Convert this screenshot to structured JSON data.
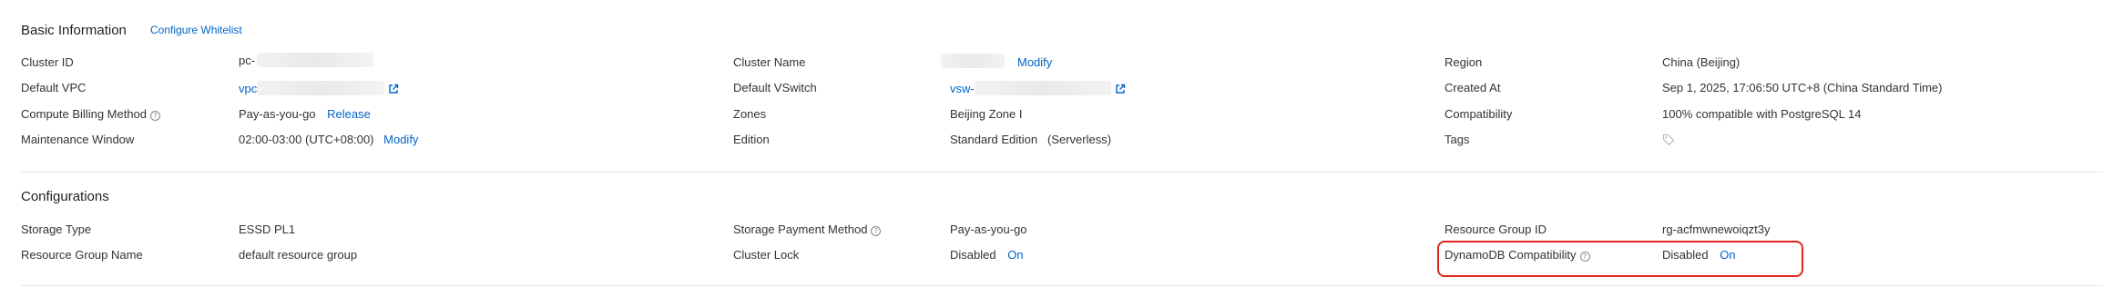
{
  "basic": {
    "title": "Basic Information",
    "configure_whitelist": "Configure Whitelist",
    "cluster_id_label": "Cluster ID",
    "cluster_id_value": "pc-",
    "cluster_name_label": "Cluster Name",
    "cluster_name_modify": "Modify",
    "region_label": "Region",
    "region_value": "China (Beijing)",
    "default_vpc_label": "Default VPC",
    "default_vpc_value": "vpc",
    "default_vswitch_label": "Default VSwitch",
    "default_vswitch_value": "vsw-",
    "created_at_label": "Created At",
    "created_at_value": "Sep 1, 2025, 17:06:50  UTC+8 (China Standard Time)",
    "billing_label": "Compute Billing Method",
    "billing_value": "Pay-as-you-go",
    "billing_release": "Release",
    "zones_label": "Zones",
    "zones_value": "Beijing Zone I",
    "compat_label": "Compatibility",
    "compat_value": "100% compatible with PostgreSQL 14",
    "maint_label": "Maintenance Window",
    "maint_value": "02:00-03:00 (UTC+08:00)",
    "maint_modify": "Modify",
    "edition_label": "Edition",
    "edition_value": "Standard Edition   (Serverless)",
    "tags_label": "Tags"
  },
  "config": {
    "title": "Configurations",
    "storage_type_label": "Storage Type",
    "storage_type_value": "ESSD PL1",
    "storage_payment_label": "Storage Payment Method",
    "storage_payment_value": "Pay-as-you-go",
    "rg_id_label": "Resource Group ID",
    "rg_id_value": "rg-acfmwnewoiqzt3y",
    "rg_name_label": "Resource Group Name",
    "rg_name_value": "default resource group",
    "lock_label": "Cluster Lock",
    "lock_value": "Disabled",
    "lock_on": "On",
    "dynamo_label": "DynamoDB Compatibility",
    "dynamo_value": "Disabled",
    "dynamo_on": "On"
  },
  "colors": {
    "link": "#0064c8",
    "highlight": "#e1251b"
  }
}
